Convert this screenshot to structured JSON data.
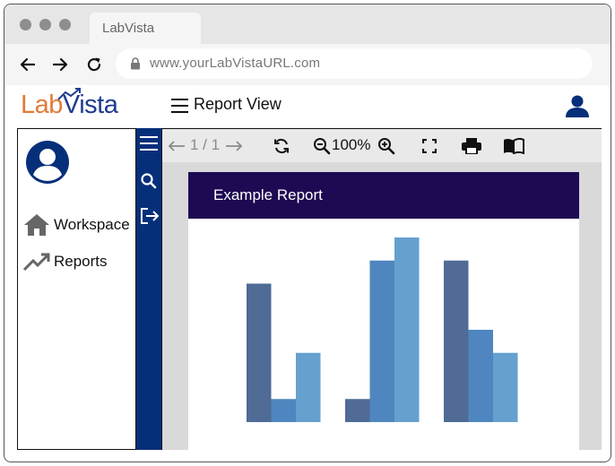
{
  "browser": {
    "tab_title": "LabVista",
    "url": "www.yourLabVistaURL.com",
    "traffic_light_color": "#8e8e8e"
  },
  "app": {
    "logo_part1": "Lab",
    "logo_part2": "Vista",
    "view_title": "Report View",
    "brand_orange": "#e07b39",
    "brand_blue": "#1f3d8f"
  },
  "sidebar": {
    "items": [
      {
        "label": "Workspace",
        "icon": "home-icon"
      },
      {
        "label": "Reports",
        "icon": "trending-up-icon"
      }
    ]
  },
  "rail": {
    "icons": [
      "menu-icon",
      "search-icon",
      "logout-icon"
    ],
    "color": "#062f7a"
  },
  "toolbar": {
    "page_current": "1",
    "page_total": "1",
    "page_text": "1 / 1",
    "zoom_text": "100%",
    "icons": [
      "arrow-left-icon",
      "arrow-right-icon",
      "refresh-icon",
      "zoom-out-icon",
      "zoom-in-icon",
      "fullscreen-icon",
      "print-icon",
      "book-icon"
    ]
  },
  "report": {
    "title": "Example Report",
    "header_color": "#1e0a52"
  },
  "chart_data": {
    "type": "bar",
    "categories": [
      "",
      "",
      ""
    ],
    "series": [
      {
        "values": [
          60,
          10,
          70
        ],
        "color": "#4f6b96"
      },
      {
        "values": [
          10,
          70,
          40
        ],
        "color": "#4f86bf"
      },
      {
        "values": [
          30,
          80,
          30
        ],
        "color": "#65a0cf"
      }
    ],
    "ylim": [
      0,
      80
    ],
    "grid": false,
    "legend": "none"
  }
}
